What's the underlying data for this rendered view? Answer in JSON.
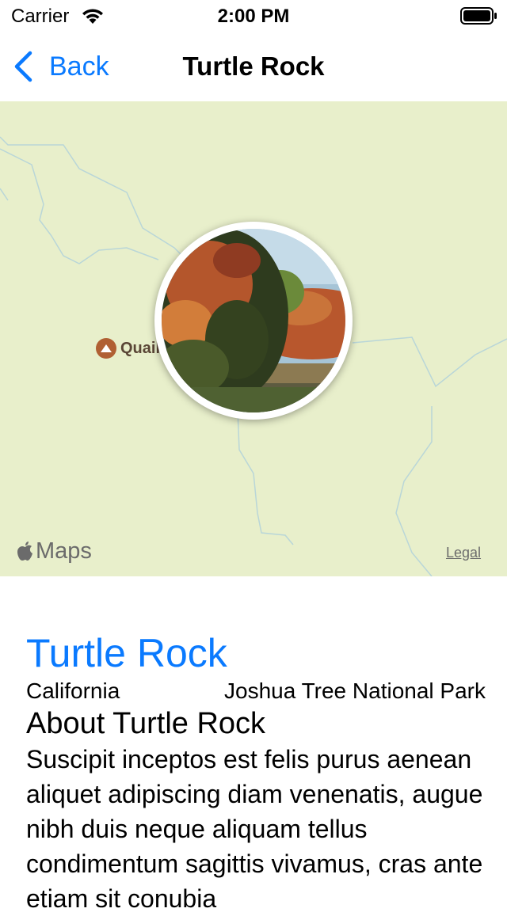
{
  "status_bar": {
    "carrier": "Carrier",
    "time": "2:00 PM"
  },
  "nav": {
    "back_label": "Back",
    "title": "Turtle Rock"
  },
  "map": {
    "poi_label": "Quail",
    "logo_text": "Maps",
    "legal_label": "Legal"
  },
  "landmark": {
    "name": "Turtle Rock",
    "state": "California",
    "park": "Joshua Tree National Park",
    "about_heading": "About Turtle Rock",
    "description": "Suscipit inceptos est felis purus aenean aliquet adipiscing diam venenatis, augue nibh duis neque aliquam tellus condimentum sagittis vivamus, cras ante etiam sit conubia"
  },
  "colors": {
    "accent": "#0a7aff",
    "map_background": "#e8efcb",
    "poi": "#b06033"
  },
  "icons": [
    "wifi-icon",
    "battery-icon",
    "back-chevron-icon",
    "mountain-icon",
    "apple-logo-icon"
  ]
}
